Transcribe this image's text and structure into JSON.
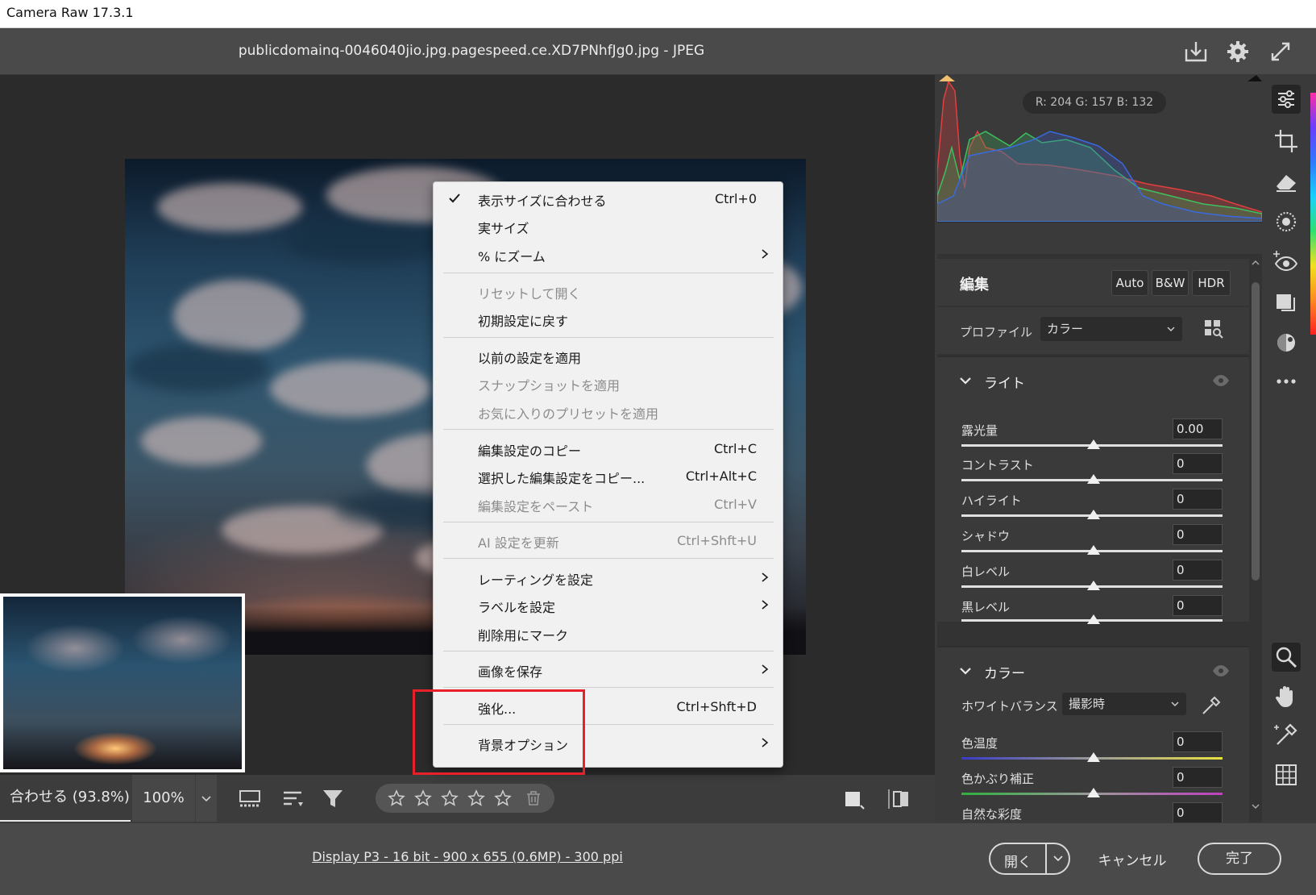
{
  "window": {
    "title": "Camera Raw 17.3.1"
  },
  "header": {
    "filename": "publicdomainq-0046040jio.jpg.pagespeed.ce.XD7PNhfJg0.jpg  -  JPEG"
  },
  "toolbar": {
    "fit_zoom": "合わせる (93.8%)",
    "zoom_100": "100%"
  },
  "status": {
    "info": "Display P3 - 16 bit - 900 x 655 (0.6MP) - 300 ppi"
  },
  "actions": {
    "open": "開く",
    "cancel": "キャンセル",
    "done": "完了"
  },
  "histogram": {
    "rgb": "R: 204   G: 157   B: 132"
  },
  "panel": {
    "title": "編集",
    "buttons": {
      "auto": "Auto",
      "bw": "B&W",
      "hdr": "HDR"
    },
    "profile_label": "プロファイル",
    "profile_value": "カラー",
    "light": {
      "title": "ライト",
      "sliders": [
        {
          "label": "露光量",
          "value": "0.00"
        },
        {
          "label": "コントラスト",
          "value": "0"
        },
        {
          "label": "ハイライト",
          "value": "0"
        },
        {
          "label": "シャドウ",
          "value": "0"
        },
        {
          "label": "白レベル",
          "value": "0"
        },
        {
          "label": "黒レベル",
          "value": "0"
        }
      ]
    },
    "color": {
      "title": "カラー",
      "wb_label": "ホワイトバランス",
      "wb_value": "撮影時",
      "sliders": [
        {
          "label": "色温度",
          "value": "0"
        },
        {
          "label": "色かぶり補正",
          "value": "0"
        },
        {
          "label": "自然な彩度",
          "value": "0"
        }
      ]
    }
  },
  "context_menu": {
    "items": [
      {
        "label": "表示サイズに合わせる",
        "shortcut": "Ctrl+0",
        "checked": true
      },
      {
        "label": "実サイズ",
        "shortcut": ""
      },
      {
        "label": "% にズーム",
        "shortcut": "",
        "submenu": true
      },
      {
        "label": "リセットして開く",
        "shortcut": "",
        "disabled": true
      },
      {
        "label": "初期設定に戻す",
        "shortcut": ""
      },
      {
        "label": "以前の設定を適用",
        "shortcut": ""
      },
      {
        "label": "スナップショットを適用",
        "shortcut": "",
        "disabled": true
      },
      {
        "label": "お気に入りのプリセットを適用",
        "shortcut": "",
        "disabled": true
      },
      {
        "label": "編集設定のコピー",
        "shortcut": "Ctrl+C"
      },
      {
        "label": "選択した編集設定をコピー...",
        "shortcut": "Ctrl+Alt+C"
      },
      {
        "label": "編集設定をペースト",
        "shortcut": "Ctrl+V",
        "disabled": true
      },
      {
        "label": "AI 設定を更新",
        "shortcut": "Ctrl+Shft+U",
        "disabled": true
      },
      {
        "label": "レーティングを設定",
        "shortcut": "",
        "submenu": true
      },
      {
        "label": "ラベルを設定",
        "shortcut": "",
        "submenu": true
      },
      {
        "label": "削除用にマーク",
        "shortcut": ""
      },
      {
        "label": "画像を保存",
        "shortcut": "",
        "submenu": true
      },
      {
        "label": "強化...",
        "shortcut": "Ctrl+Shft+D"
      },
      {
        "label": "背景オプション",
        "shortcut": "",
        "submenu": true
      }
    ]
  },
  "icons": [
    "download-icon",
    "gear-icon",
    "expand-icon",
    "edit-sliders-icon",
    "crop-icon",
    "eraser-icon",
    "mask-icon",
    "redeye-icon",
    "layers-icon",
    "presets-icon",
    "more-icon",
    "zoom-icon",
    "hand-icon",
    "eyedropper-icon",
    "grid-icon"
  ],
  "colors": {
    "highlight": "#e8202a",
    "menu_bg": "#f1f1f1",
    "panel_bg": "#3a3a3a"
  }
}
